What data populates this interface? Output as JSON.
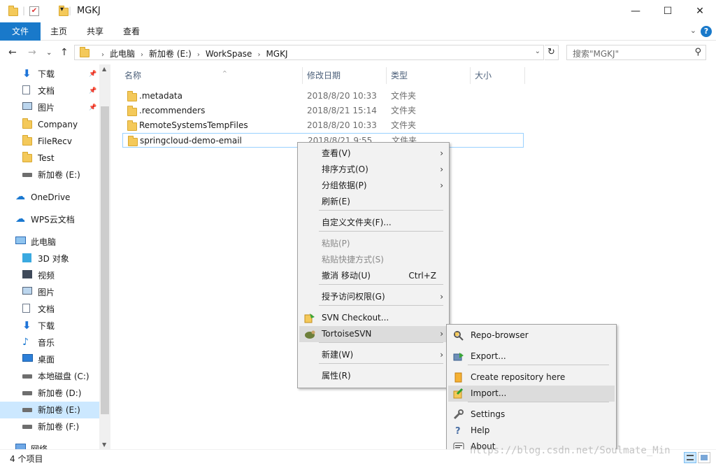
{
  "window": {
    "title": "MGKJ",
    "minimize": "—",
    "maximize": "☐",
    "close": "✕"
  },
  "ribbon": {
    "tabs": [
      "文件",
      "主页",
      "共享",
      "查看"
    ],
    "help": "?"
  },
  "address": {
    "crumbs": [
      "此电脑",
      "新加卷 (E:)",
      "WorkSpase",
      "MGKJ"
    ],
    "search_placeholder": "搜索\"MGKJ\""
  },
  "sidebar": {
    "items": [
      {
        "label": "下载",
        "icon": "download-icon",
        "pinned": true
      },
      {
        "label": "文档",
        "icon": "document-icon",
        "pinned": true
      },
      {
        "label": "图片",
        "icon": "picture-icon",
        "pinned": true
      },
      {
        "label": "Company",
        "icon": "folder-icon"
      },
      {
        "label": "FileRecv",
        "icon": "folder-icon"
      },
      {
        "label": "Test",
        "icon": "folder-icon"
      },
      {
        "label": "新加卷 (E:)",
        "icon": "drive-icon"
      },
      {
        "label": "OneDrive",
        "icon": "cloud-icon"
      },
      {
        "label": "WPS云文档",
        "icon": "cloud-icon"
      },
      {
        "label": "此电脑",
        "icon": "computer-icon"
      },
      {
        "label": "3D 对象",
        "icon": "3d-objects-icon"
      },
      {
        "label": "视频",
        "icon": "video-icon"
      },
      {
        "label": "图片",
        "icon": "picture-icon"
      },
      {
        "label": "文档",
        "icon": "document-icon"
      },
      {
        "label": "下载",
        "icon": "download-icon"
      },
      {
        "label": "音乐",
        "icon": "music-icon"
      },
      {
        "label": "桌面",
        "icon": "desktop-icon"
      },
      {
        "label": "本地磁盘 (C:)",
        "icon": "drive-icon"
      },
      {
        "label": "新加卷 (D:)",
        "icon": "drive-icon"
      },
      {
        "label": "新加卷 (E:)",
        "icon": "drive-icon",
        "selected": true
      },
      {
        "label": "新加卷 (F:)",
        "icon": "drive-icon"
      },
      {
        "label": "网络",
        "icon": "network-icon"
      }
    ]
  },
  "list": {
    "columns": [
      "名称",
      "修改日期",
      "类型",
      "大小"
    ],
    "rows": [
      {
        "name": ".metadata",
        "date": "2018/8/20 10:33",
        "type": "文件夹"
      },
      {
        "name": ".recommenders",
        "date": "2018/8/21 15:14",
        "type": "文件夹"
      },
      {
        "name": "RemoteSystemsTempFiles",
        "date": "2018/8/20 10:33",
        "type": "文件夹"
      },
      {
        "name": "springcloud-demo-email",
        "date": "2018/8/21 9:55",
        "type": "文件夹"
      }
    ]
  },
  "context_menu": {
    "items": [
      {
        "label": "查看(V)",
        "submenu": true
      },
      {
        "label": "排序方式(O)",
        "submenu": true
      },
      {
        "label": "分组依据(P)",
        "submenu": true
      },
      {
        "label": "刷新(E)"
      },
      {
        "label": "自定义文件夹(F)..."
      },
      {
        "label": "粘贴(P)",
        "disabled": true
      },
      {
        "label": "粘贴快捷方式(S)",
        "disabled": true
      },
      {
        "label": "撤消 移动(U)",
        "shortcut": "Ctrl+Z"
      },
      {
        "label": "授予访问权限(G)",
        "submenu": true
      },
      {
        "label": "SVN Checkout..."
      },
      {
        "label": "TortoiseSVN",
        "submenu": true,
        "highlighted": true
      },
      {
        "label": "新建(W)",
        "submenu": true
      },
      {
        "label": "属性(R)"
      }
    ]
  },
  "svn_menu": {
    "items": [
      {
        "label": "Repo-browser"
      },
      {
        "label": "Export..."
      },
      {
        "label": "Create repository here"
      },
      {
        "label": "Import...",
        "highlighted": true
      },
      {
        "label": "Settings"
      },
      {
        "label": "Help"
      },
      {
        "label": "About"
      }
    ]
  },
  "status": {
    "count": "4 个项目"
  },
  "watermark": "https://blog.csdn.net/Soulmate_Min",
  "colors": {
    "accent": "#1979ca",
    "selection": "#cce8ff",
    "folder": "#f4c95a"
  }
}
